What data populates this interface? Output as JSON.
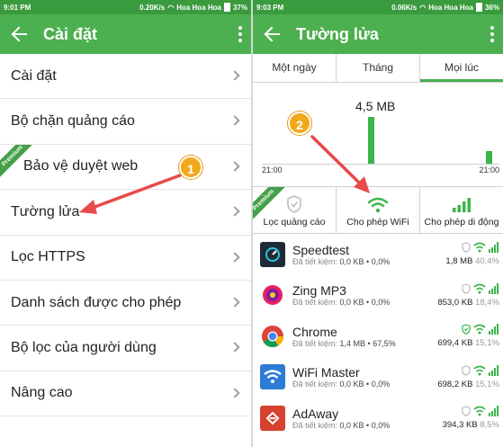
{
  "left": {
    "status": {
      "time": "9:01 PM",
      "speed": "0.20K/s",
      "carrier": "Hoa Hoa Hoa",
      "battery": "37%"
    },
    "title": "Cài đặt",
    "items": [
      {
        "label": "Cài đặt"
      },
      {
        "label": "Bộ chặn quảng cáo"
      },
      {
        "label": "Bảo vệ duyệt web",
        "badge": "Premium"
      },
      {
        "label": "Tường lửa"
      },
      {
        "label": "Lọc HTTPS"
      },
      {
        "label": "Danh sách được cho phép"
      },
      {
        "label": "Bộ lọc của người dùng"
      },
      {
        "label": "Nâng cao"
      }
    ],
    "callout": "1"
  },
  "right": {
    "status": {
      "time": "9:03 PM",
      "speed": "0.06K/s",
      "carrier": "Hoa Hoa Hoa",
      "battery": "36%"
    },
    "title": "Tường lửa",
    "tabs": [
      {
        "label": "Một ngày"
      },
      {
        "label": "Tháng"
      },
      {
        "label": "Mọi lúc"
      }
    ],
    "active_tab": 2,
    "chart": {
      "peak_label": "4,5 MB",
      "time_left": "21:00",
      "time_right": "21:00"
    },
    "callout": "2",
    "badge": "Premium",
    "toggles": [
      {
        "label": "Lọc quảng cáo",
        "icon": "shield-icon",
        "color": "#bdbdbd"
      },
      {
        "label": "Cho phép WiFi",
        "icon": "wifi-icon",
        "color": "#3bb44a"
      },
      {
        "label": "Cho phép di động",
        "icon": "cellular-icon",
        "color": "#3bb44a"
      }
    ],
    "apps": [
      {
        "name": "Speedtest",
        "saved_label": "Đã tiết kiệm:",
        "saved": "0,0 KB • 0,0%",
        "traffic": "1,8 MB",
        "pct": "40,4%",
        "icon_color": "#1e2a3a"
      },
      {
        "name": "Zing MP3",
        "saved_label": "Đã tiết kiệm:",
        "saved": "0,0 KB • 0,0%",
        "traffic": "853,0 KB",
        "pct": "18,4%",
        "icon_color": "#ffffff"
      },
      {
        "name": "Chrome",
        "saved_label": "Đã tiết kiệm:",
        "saved": "1,4 MB • 67,5%",
        "traffic": "699,4 KB",
        "pct": "15,1%",
        "icon_color": "#ffffff"
      },
      {
        "name": "WiFi Master",
        "saved_label": "Đã tiết kiệm:",
        "saved": "0,0 KB • 0,0%",
        "traffic": "698,2 KB",
        "pct": "15,1%",
        "icon_color": "#2e7bd6"
      },
      {
        "name": "AdAway",
        "saved_label": "Đã tiết kiệm:",
        "saved": "0,0 KB • 0,0%",
        "traffic": "394,3 KB",
        "pct": "8,5%",
        "icon_color": "#d8412f"
      }
    ]
  },
  "colors": {
    "toolbar": "#4caf50",
    "statusbar": "#3a9b3e",
    "accent": "#3bb44a",
    "callout": "#f2a81d",
    "arrow": "#e84a4a"
  }
}
